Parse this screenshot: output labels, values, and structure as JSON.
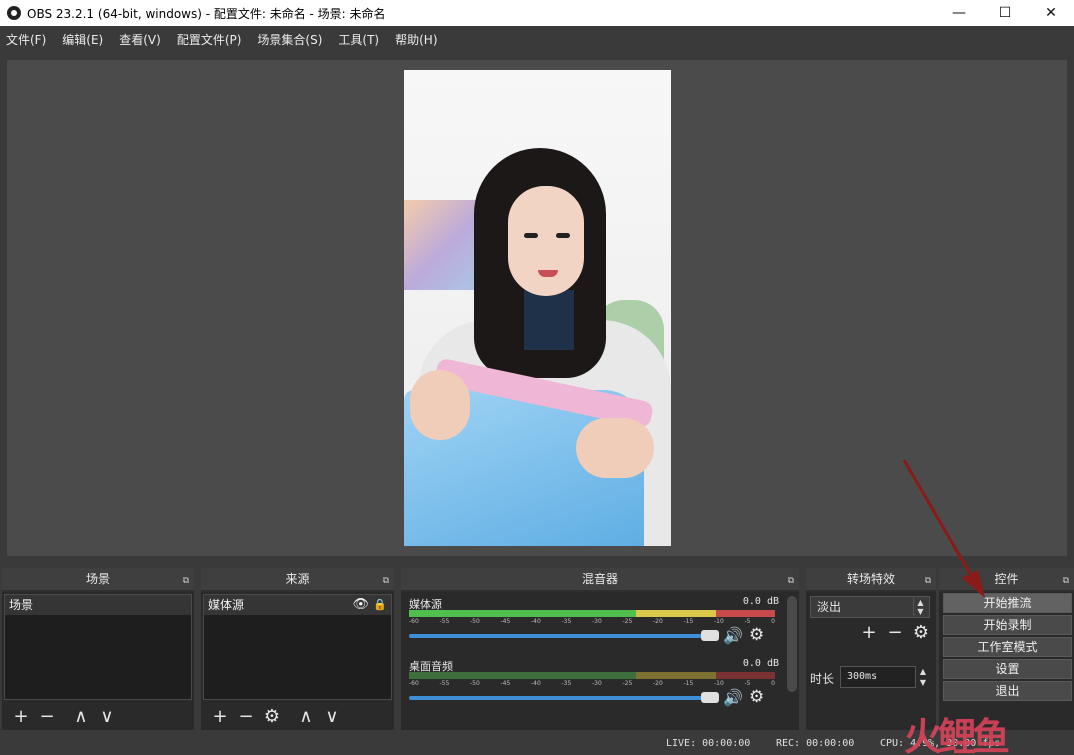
{
  "window": {
    "title": "OBS 23.2.1 (64-bit, windows) - 配置文件: 未命名 - 场景: 未命名",
    "minimize": "—",
    "maximize": "☐",
    "close": "✕"
  },
  "menu": [
    "文件(F)",
    "编辑(E)",
    "查看(V)",
    "配置文件(P)",
    "场景集合(S)",
    "工具(T)",
    "帮助(H)"
  ],
  "docks": {
    "scenes": {
      "title": "场景",
      "items": [
        "场景"
      ]
    },
    "sources": {
      "title": "来源",
      "items": [
        "媒体源"
      ]
    },
    "mixer": {
      "title": "混音器",
      "tracks": [
        {
          "name": "媒体源",
          "db": "0.0 dB"
        },
        {
          "name": "桌面音频",
          "db": "0.0 dB"
        }
      ],
      "ticks": [
        "-60",
        "-55",
        "-50",
        "-45",
        "-40",
        "-35",
        "-30",
        "-25",
        "-20",
        "-15",
        "-10",
        "-5",
        "0"
      ]
    },
    "transitions": {
      "title": "转场特效",
      "selected": "淡出",
      "duration_label": "时长",
      "duration_value": "300ms"
    },
    "controls": {
      "title": "控件",
      "buttons": [
        "开始推流",
        "开始录制",
        "工作室模式",
        "设置",
        "退出"
      ]
    }
  },
  "status": {
    "live": "LIVE: 00:00:00",
    "rec": "REC: 00:00:00",
    "cpu": "CPU: 4.9%, 30.00 fps"
  },
  "watermark": "火鲤鱼",
  "icons": {
    "plus": "+",
    "minus": "−",
    "up": "∧",
    "down": "∨",
    "gear": "⚙",
    "eye": "👁",
    "lock": "🔒",
    "speaker": "🔊",
    "float": "⧉"
  },
  "colors": {
    "annotation_arrow": "#8b1a1a",
    "meter_green": "#4fbf4f",
    "meter_yellow": "#d9c84a",
    "meter_red": "#c94a4a",
    "slider": "#3e8ed8"
  }
}
